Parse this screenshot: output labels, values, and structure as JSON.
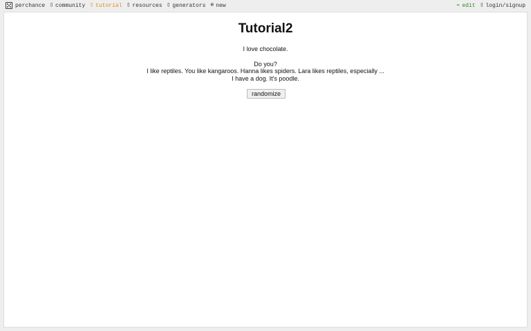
{
  "nav": {
    "left": [
      {
        "label": "perchance",
        "icon": "dice-icon"
      },
      {
        "label": "community",
        "icon": "chat-icon"
      },
      {
        "label": "tutorial",
        "icon": "book-icon",
        "active": true
      },
      {
        "label": "resources",
        "icon": "folder-icon"
      },
      {
        "label": "generators",
        "icon": "gear-icon"
      },
      {
        "label": "new",
        "icon": "plus-circle-icon"
      }
    ],
    "right": [
      {
        "label": "edit",
        "icon": "pencil-icon"
      },
      {
        "label": "login/signup",
        "icon": "user-icon"
      }
    ]
  },
  "main": {
    "title": "Tutorial2",
    "line1": "I love chocolate.",
    "line2": "Do you?",
    "line3": "I like reptiles. You like kangaroos. Hanna likes spiders. Lara likes reptiles, especially ...",
    "line4": "I have a dog. It's poodle.",
    "button_label": "randomize"
  },
  "colors": {
    "active_nav": "#e08a1e",
    "edit": "#3a8a2a",
    "background": "#eeeeee"
  }
}
